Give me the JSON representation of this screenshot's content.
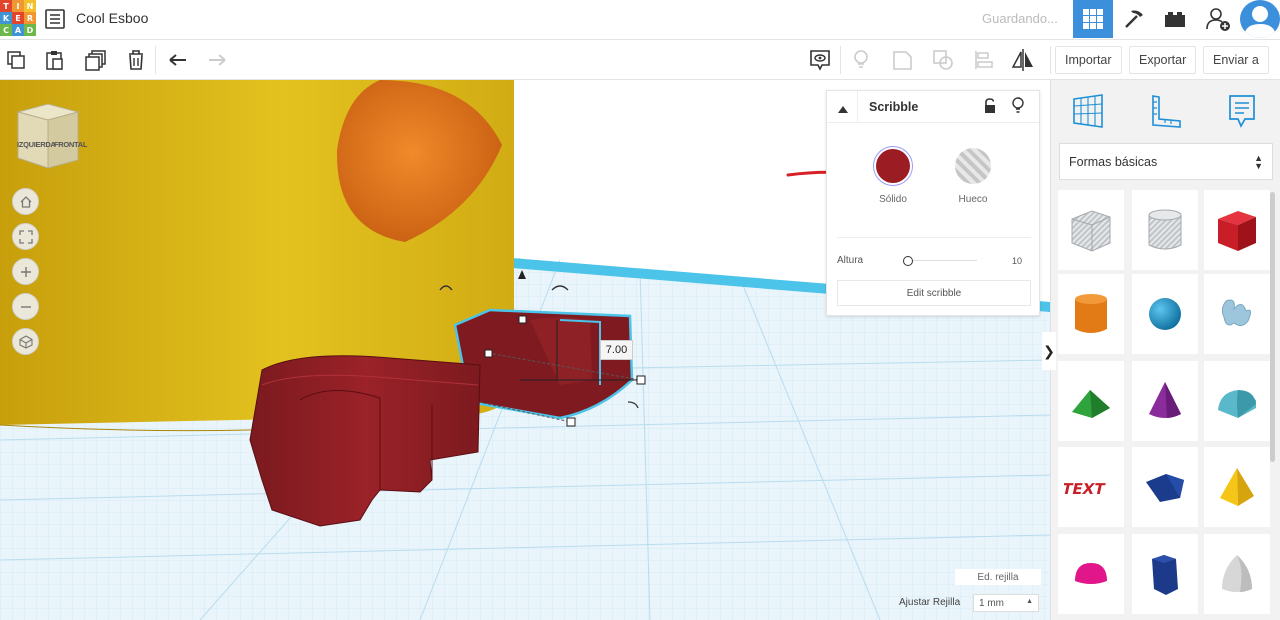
{
  "app": {
    "logo_letters": [
      "T",
      "I",
      "N",
      "K",
      "E",
      "R",
      "C",
      "A",
      "D"
    ],
    "logo_colors": [
      "#e2452c",
      "#f19630",
      "#f3c22b",
      "#3f95d3",
      "#e2452c",
      "#f19630",
      "#6cb84b",
      "#3f95d3",
      "#6cb84b"
    ],
    "title": "Cool Esboo",
    "status": "Guardando..."
  },
  "header_icons": [
    "grid-view-icon",
    "pickaxe-icon",
    "bricks-icon",
    "add-user-icon",
    "user-avatar-icon"
  ],
  "toolbar": {
    "tools": [
      "copy-icon",
      "paste-icon",
      "duplicate-icon",
      "delete-icon",
      "undo-icon",
      "redo-icon"
    ],
    "view_tools": [
      "notes-icon",
      "light-icon",
      "group-icon",
      "hole-group-icon",
      "align-icon",
      "mirror-icon"
    ],
    "import_label": "Importar",
    "export_label": "Exportar",
    "send_label": "Enviar a"
  },
  "viewcube": {
    "left_face": "IZQUIERDA",
    "front_face": "FRONTAL"
  },
  "view_controls": [
    "home-icon",
    "fit-view-icon",
    "zoom-in-icon",
    "zoom-out-icon",
    "projection-icon"
  ],
  "scene": {
    "dimension_value": "7.00",
    "colors": {
      "body": "#d9b516",
      "beak": "#e07a1c",
      "feet": "#8e1f24",
      "grid": "#b9dcee",
      "select": "#4cc3e8"
    }
  },
  "inspector": {
    "title": "Scribble",
    "solid_label": "Sólido",
    "hole_label": "Hueco",
    "solid_color": "#9c1c24",
    "height_label": "Altura",
    "height_value": "10",
    "height_level": 0,
    "edit_label": "Edit scribble"
  },
  "panel": {
    "tabs": [
      "workplane-icon",
      "ruler-icon",
      "notes-panel-icon"
    ],
    "shape_category": "Formas básicas",
    "shapes": [
      "box-hole",
      "cylinder-hole",
      "box",
      "cylinder",
      "sphere",
      "scribble",
      "roof",
      "cone",
      "round-roof",
      "text",
      "polygon",
      "pyramid",
      "half-sphere",
      "hexagonal-prism",
      "paraboloid"
    ]
  },
  "grid": {
    "edit_label": "Ed. rejilla",
    "snap_label": "Ajustar Rejilla",
    "snap_value": "1 mm"
  }
}
